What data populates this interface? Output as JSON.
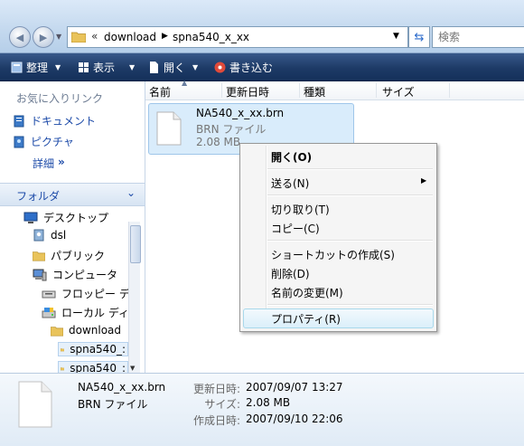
{
  "address": {
    "breadcrumb_chevron": "«",
    "segments": [
      "download",
      "spna540_x_xx"
    ],
    "search_placeholder": "検索"
  },
  "toolbar": {
    "organize": "整理",
    "views": "表示",
    "open": "開く",
    "burn": "書き込む"
  },
  "sidebar": {
    "favorites_title": "お気に入りリンク",
    "favorites": [
      "ドキュメント",
      "ピクチャ"
    ],
    "more": "詳細",
    "folders_title": "フォルダ",
    "tree": [
      "デスクトップ",
      "dsl",
      "パブリック",
      "コンピュータ",
      "フロッピー デ",
      "ローカル ディ",
      "download",
      "spna540_:",
      "spna540_:"
    ]
  },
  "columns": [
    "名前",
    "更新日時",
    "種類",
    "サイズ"
  ],
  "file": {
    "name": "NA540_x_xx.brn",
    "type": "BRN ファイル",
    "size": "2.08 MB"
  },
  "context_menu": {
    "open": "開く(O)",
    "send_to": "送る(N)",
    "cut": "切り取り(T)",
    "copy": "コピー(C)",
    "create_shortcut": "ショートカットの作成(S)",
    "delete": "削除(D)",
    "rename": "名前の変更(M)",
    "properties": "プロパティ(R)"
  },
  "details": {
    "name": "NA540_x_xx.brn",
    "type": "BRN ファイル",
    "modified_label": "更新日時:",
    "modified": "2007/09/07 13:27",
    "size_label": "サイズ:",
    "size": "2.08 MB",
    "created_label": "作成日時:",
    "created": "2007/09/10 22:06"
  },
  "colors": {
    "toolbar": "#1d3a66",
    "link": "#1c4aa8",
    "selection": "#d9ecfb"
  }
}
